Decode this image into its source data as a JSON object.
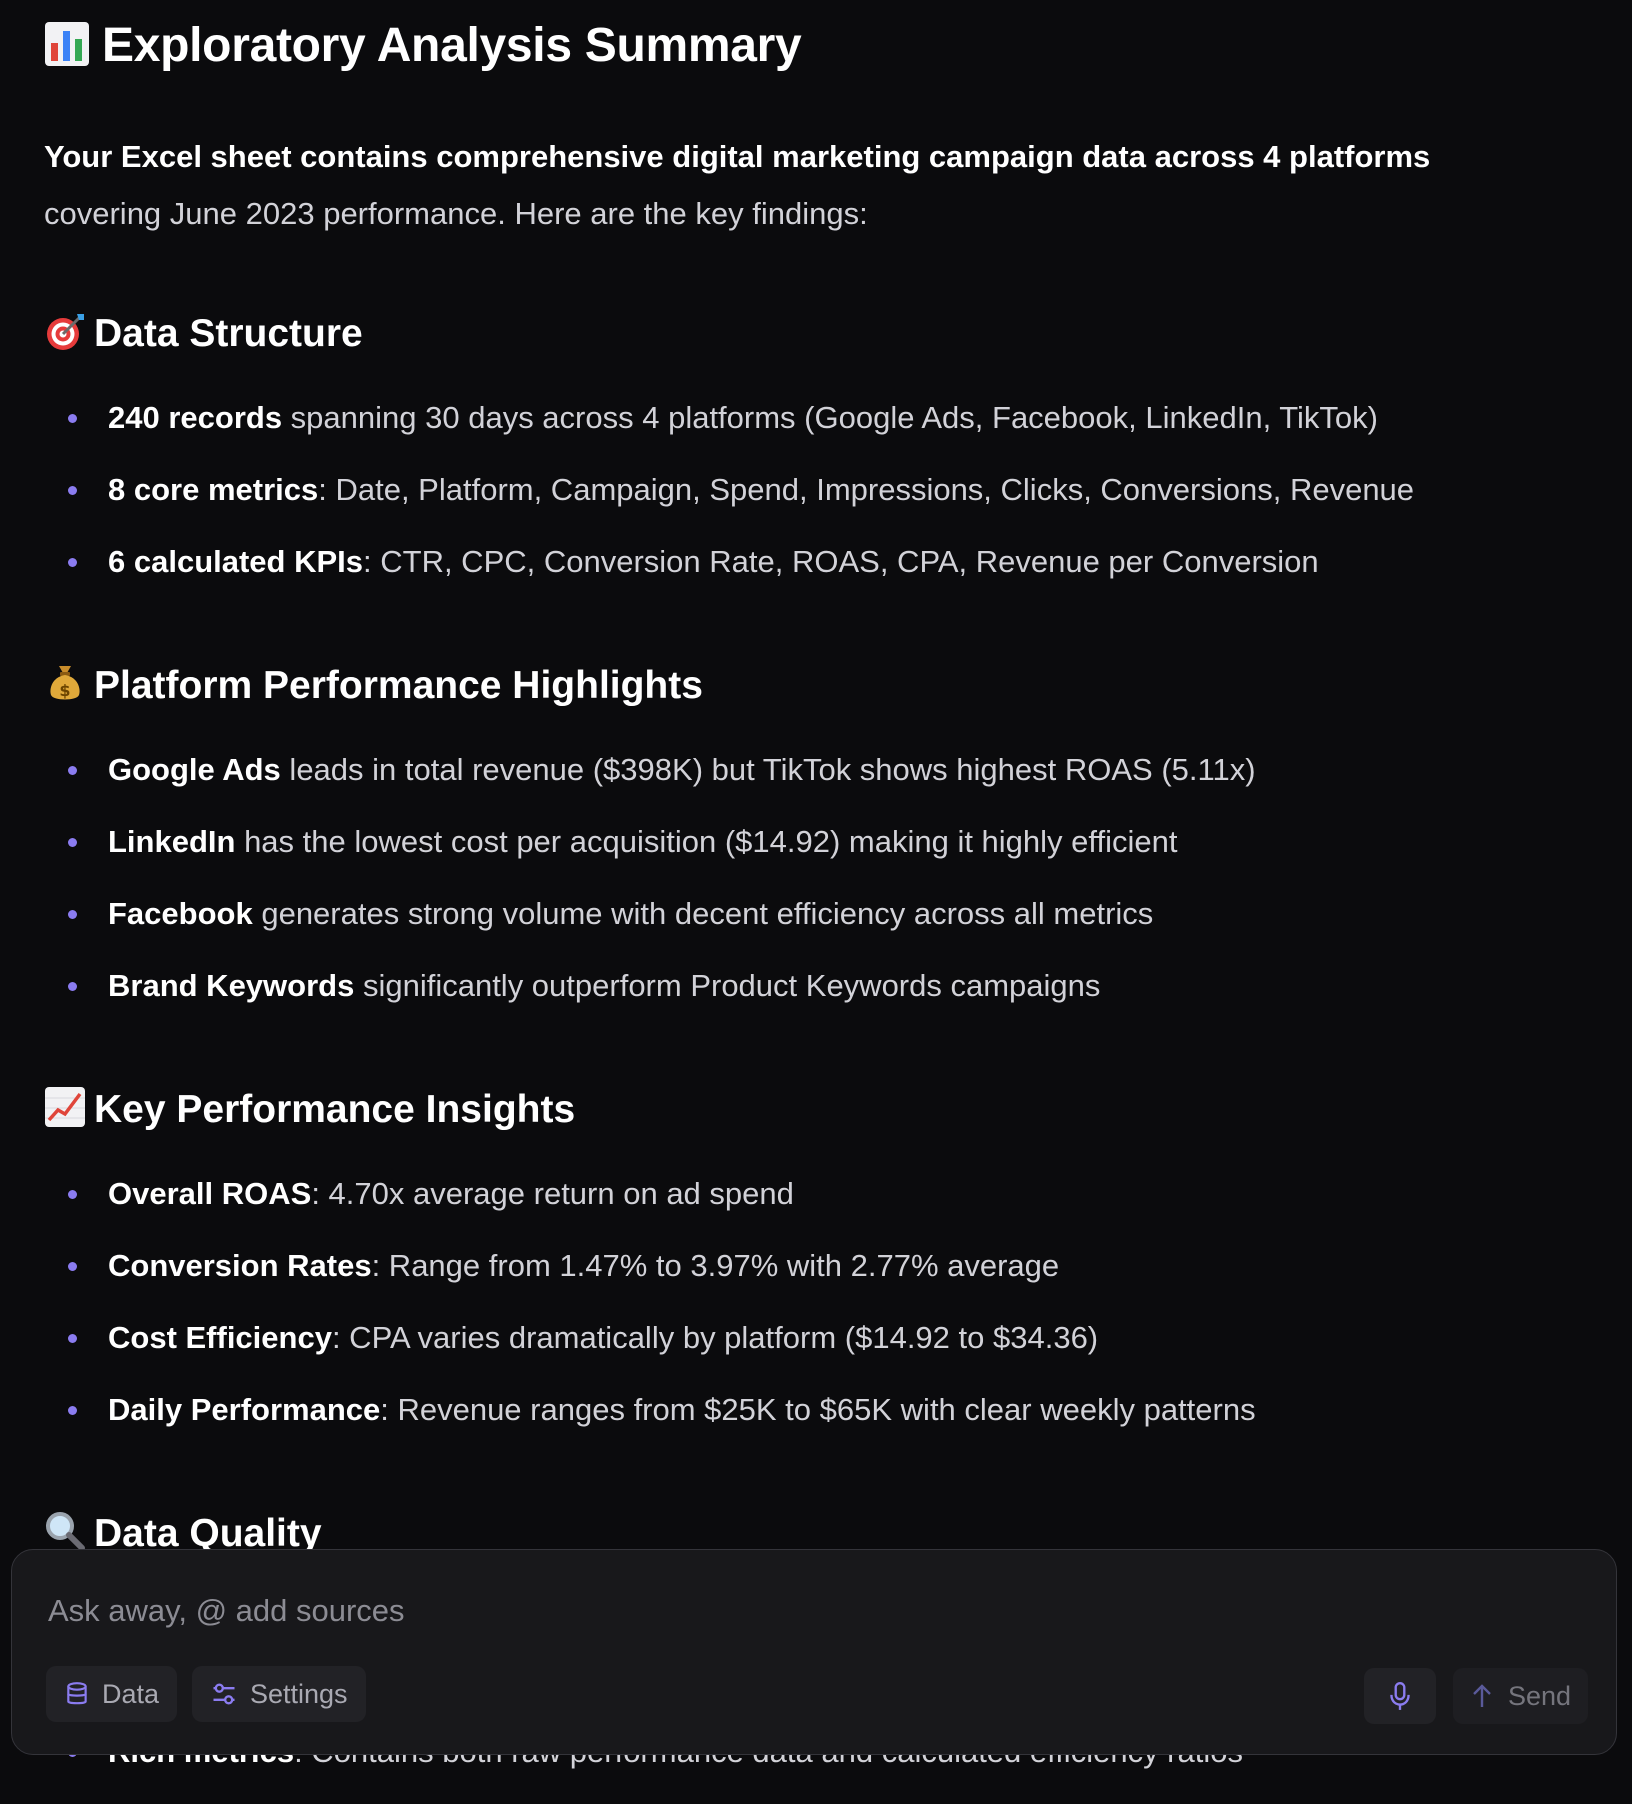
{
  "title": {
    "emoji": "bar-chart-emoji",
    "text": "Exploratory Analysis Summary"
  },
  "intro": {
    "bold": "Your Excel sheet contains comprehensive digital marketing campaign data across 4 platforms",
    "rest": " covering June 2023 performance. Here are the key findings:"
  },
  "sections": [
    {
      "emoji": "direct-hit-emoji",
      "heading": "Data Structure",
      "items": [
        {
          "bold": "240 records",
          "text": " spanning 30 days across 4 platforms (Google Ads, Facebook, LinkedIn, TikTok)"
        },
        {
          "bold": "8 core metrics",
          "text": ": Date, Platform, Campaign, Spend, Impressions, Clicks, Conversions, Revenue"
        },
        {
          "bold": "6 calculated KPIs",
          "text": ": CTR, CPC, Conversion Rate, ROAS, CPA, Revenue per Conversion"
        }
      ]
    },
    {
      "emoji": "money-bag-emoji",
      "heading": "Platform Performance Highlights",
      "items": [
        {
          "bold": "Google Ads",
          "text": " leads in total revenue ($398K) but TikTok shows highest ROAS (5.11x)"
        },
        {
          "bold": "LinkedIn",
          "text": " has the lowest cost per acquisition ($14.92) making it highly efficient"
        },
        {
          "bold": "Facebook",
          "text": " generates strong volume with decent efficiency across all metrics"
        },
        {
          "bold": "Brand Keywords",
          "text": " significantly outperform Product Keywords campaigns"
        }
      ]
    },
    {
      "emoji": "chart-increasing-emoji",
      "heading": "Key Performance Insights",
      "items": [
        {
          "bold": "Overall ROAS",
          "text": ": 4.70x average return on ad spend"
        },
        {
          "bold": "Conversion Rates",
          "text": ": Range from 1.47% to 3.97% with 2.77% average"
        },
        {
          "bold": "Cost Efficiency",
          "text": ": CPA varies dramatically by platform ($14.92 to $34.36)"
        },
        {
          "bold": "Daily Performance",
          "text": ": Revenue ranges from $25K to $65K with clear weekly patterns"
        }
      ]
    },
    {
      "emoji": "magnifying-glass-emoji",
      "heading": "Data Quality",
      "items": [
        {
          "bold": "Rich metrics",
          "text": ": Contains both raw performance data and calculated efficiency ratios"
        }
      ]
    }
  ],
  "composer": {
    "placeholder": "Ask away, @ add sources",
    "value": "",
    "data_label": "Data",
    "settings_label": "Settings",
    "mic_icon": "microphone-icon",
    "send_label": "Send"
  },
  "colors": {
    "background": "#0b0b0d",
    "bullet": "#8b7cf0",
    "composer_bg": "#18181b",
    "accent_icon": "#8b7cf0"
  }
}
